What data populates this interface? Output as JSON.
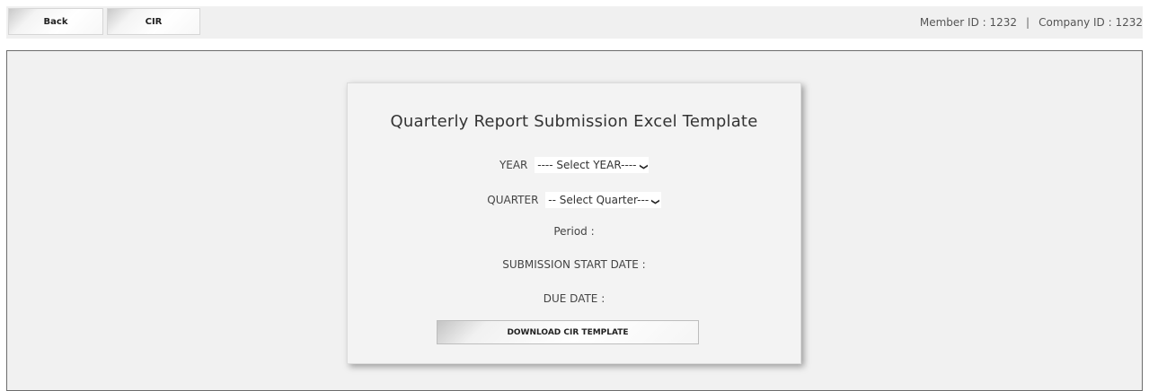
{
  "toolbar": {
    "back_label": "Back",
    "cir_label": "CIR"
  },
  "ids": {
    "member": "Member ID : 1232",
    "separator": "|",
    "company": "Company ID : 1232"
  },
  "card": {
    "title": "Quarterly Report Submission Excel Template",
    "year_label": "YEAR",
    "year_selected": "---- Select YEAR----",
    "quarter_label": "QUARTER",
    "quarter_selected": "-- Select Quarter---",
    "period_label": "Period :",
    "start_date_label": "SUBMISSION START DATE :",
    "due_date_label": "DUE DATE :",
    "download_label": "DOWNLOAD CIR TEMPLATE"
  },
  "icons": {
    "dropdown": "chevron-down-icon"
  }
}
